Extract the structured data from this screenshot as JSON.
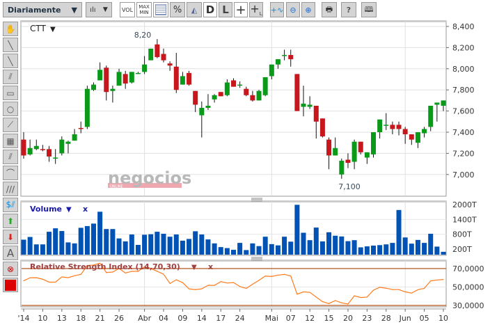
{
  "toolbar": {
    "period": "Diariamente",
    "vol": "VOL",
    "max": "MAX",
    "min": "MIN",
    "percent": "%",
    "d": "D",
    "l": "L",
    "help": "?"
  },
  "left_tools": [
    "hand",
    "line",
    "diagonal-line",
    "parallel-lines",
    "rectangle",
    "circle",
    "fan",
    "fibonacci",
    "channel",
    "arc",
    "hatch",
    "dollar-lines",
    "arrow-up",
    "arrow-down",
    "text",
    "delete",
    "color"
  ],
  "left_text_label": "A",
  "chart": {
    "symbol": "CTT",
    "high_annotation": "8,20",
    "low_annotation": "7,100",
    "watermark": "negocios",
    "watermark_sub": "ONLINE"
  },
  "volume_panel": {
    "title": "Volume",
    "close": "x"
  },
  "rsi_panel": {
    "title": "Relative Strength Index (14,70,30)",
    "close": "x"
  },
  "colors": {
    "up": "#0a9a1a",
    "down": "#c8161d",
    "volume": "#0052b4",
    "rsi": "#ff7b1c",
    "rsi_bounds": "#b5541a",
    "title_volume": "#1a1aa8",
    "title_rsi": "#a04040"
  },
  "chart_data": {
    "type": "candlestick",
    "price_axis": {
      "min": 6.85,
      "max": 8.45,
      "ticks": [
        "8,400",
        "8,200",
        "8,000",
        "7,800",
        "7,600",
        "7,400",
        "7,200",
        "7,000"
      ],
      "tick_values": [
        8.4,
        8.2,
        8.0,
        7.8,
        7.6,
        7.4,
        7.2,
        7.0
      ]
    },
    "x_labels": [
      "'14",
      "10",
      "13",
      "18",
      "21",
      "26",
      "Abr",
      "04",
      "09",
      "14",
      "17",
      "24",
      "Mai",
      "07",
      "12",
      "15",
      "20",
      "23",
      "28",
      "Jun",
      "05",
      "10"
    ],
    "x_label_index": [
      0,
      3,
      6,
      9,
      12,
      15,
      19,
      22,
      25,
      28,
      31,
      34,
      39,
      42,
      45,
      48,
      51,
      54,
      57,
      60,
      63,
      66
    ],
    "ohlc": [
      [
        7.33,
        7.4,
        7.15,
        7.18
      ],
      [
        7.19,
        7.33,
        7.18,
        7.25
      ],
      [
        7.24,
        7.33,
        7.23,
        7.27
      ],
      [
        7.24,
        7.28,
        7.22,
        7.23
      ],
      [
        7.24,
        7.27,
        7.12,
        7.17
      ],
      [
        7.155,
        7.24,
        7.1,
        7.16
      ],
      [
        7.2,
        7.36,
        7.18,
        7.33
      ],
      [
        7.29,
        7.32,
        7.2,
        7.31
      ],
      [
        7.32,
        7.43,
        7.32,
        7.38
      ],
      [
        7.44,
        7.5,
        7.39,
        7.43
      ],
      [
        7.45,
        7.84,
        7.43,
        7.81
      ],
      [
        7.8,
        7.87,
        7.79,
        7.85
      ],
      [
        7.89,
        8.06,
        7.89,
        7.99
      ],
      [
        8.01,
        8.03,
        7.7,
        7.78
      ],
      [
        7.79,
        7.84,
        7.68,
        7.81
      ],
      [
        7.84,
        8.0,
        7.84,
        7.97
      ],
      [
        7.95,
        7.98,
        7.81,
        7.86
      ],
      [
        7.87,
        7.97,
        7.86,
        7.97
      ],
      [
        7.96,
        7.97,
        7.95,
        7.96
      ],
      [
        7.97,
        8.12,
        7.95,
        8.04
      ],
      [
        8.08,
        8.19,
        8.08,
        8.19
      ],
      [
        8.23,
        8.28,
        8.1,
        8.11
      ],
      [
        8.14,
        8.19,
        8.06,
        8.08
      ],
      [
        8.05,
        8.07,
        7.98,
        8.03
      ],
      [
        8.02,
        8.15,
        7.77,
        7.8
      ],
      [
        7.85,
        7.97,
        7.85,
        7.93
      ],
      [
        7.96,
        7.98,
        7.84,
        7.85
      ],
      [
        7.79,
        7.79,
        7.59,
        7.66
      ],
      [
        7.56,
        7.69,
        7.35,
        7.63
      ],
      [
        7.63,
        7.76,
        7.61,
        7.65
      ],
      [
        7.71,
        7.76,
        7.68,
        7.75
      ],
      [
        7.78,
        7.78,
        7.74,
        7.74
      ],
      [
        7.75,
        7.9,
        7.74,
        7.87
      ],
      [
        7.89,
        7.91,
        7.83,
        7.83
      ],
      [
        7.85,
        7.88,
        7.82,
        7.85
      ],
      [
        7.81,
        7.83,
        7.74,
        7.75
      ],
      [
        7.75,
        7.79,
        7.69,
        7.7
      ],
      [
        7.7,
        7.8,
        7.7,
        7.79
      ],
      [
        7.75,
        7.92,
        7.74,
        7.92
      ],
      [
        7.93,
        8.04,
        7.9,
        8.04
      ],
      [
        8.04,
        8.09,
        8.0,
        8.09
      ],
      [
        8.13,
        8.18,
        8.08,
        8.13
      ],
      [
        8.13,
        8.18,
        8.02,
        8.09
      ],
      [
        7.95,
        7.95,
        7.6,
        7.6
      ],
      [
        7.64,
        7.84,
        7.55,
        7.67
      ],
      [
        7.64,
        7.74,
        7.62,
        7.66
      ],
      [
        7.65,
        7.65,
        7.34,
        7.5
      ],
      [
        7.53,
        7.53,
        7.35,
        7.36
      ],
      [
        7.33,
        7.35,
        7.05,
        7.18
      ],
      [
        7.18,
        7.35,
        7.18,
        7.25
      ],
      [
        7.0,
        7.15,
        6.96,
        7.13
      ],
      [
        7.14,
        7.2,
        7.06,
        7.11
      ],
      [
        7.12,
        7.33,
        7.05,
        7.31
      ],
      [
        7.31,
        7.31,
        7.19,
        7.21
      ],
      [
        7.16,
        7.21,
        7.1,
        7.21
      ],
      [
        7.19,
        7.4,
        7.16,
        7.4
      ],
      [
        7.4,
        7.52,
        7.34,
        7.52
      ],
      [
        7.47,
        7.58,
        7.42,
        7.47
      ],
      [
        7.47,
        7.5,
        7.38,
        7.43
      ],
      [
        7.47,
        7.5,
        7.37,
        7.43
      ],
      [
        7.43,
        7.45,
        7.29,
        7.38
      ],
      [
        7.38,
        7.38,
        7.28,
        7.33
      ],
      [
        7.3,
        7.4,
        7.25,
        7.4
      ],
      [
        7.39,
        7.45,
        7.35,
        7.43
      ],
      [
        7.45,
        7.65,
        7.41,
        7.65
      ],
      [
        7.66,
        7.68,
        7.5,
        7.68
      ],
      [
        7.65,
        7.7,
        7.6,
        7.7
      ]
    ],
    "volume_axis": {
      "ticks": [
        "2000T",
        "1400T",
        "800T",
        "200T"
      ],
      "tick_values": [
        2000,
        1400,
        800,
        200
      ]
    },
    "volume": [
      580,
      690,
      390,
      390,
      900,
      1040,
      930,
      470,
      430,
      1060,
      1130,
      1230,
      1710,
      1010,
      1010,
      630,
      510,
      790,
      370,
      780,
      800,
      900,
      820,
      700,
      790,
      540,
      610,
      920,
      790,
      590,
      430,
      280,
      240,
      170,
      450,
      160,
      430,
      320,
      700,
      400,
      350,
      700,
      500,
      1990,
      860,
      560,
      1070,
      510,
      880,
      740,
      710,
      520,
      560,
      270,
      310,
      340,
      360,
      390,
      450,
      1780,
      670,
      420,
      570,
      450,
      820,
      300,
      90
    ],
    "rsi_axis": {
      "ticks": [
        "70,0000",
        "50,0000",
        "30,0000"
      ],
      "tick_values": [
        70,
        50,
        30
      ]
    },
    "rsi": [
      56.8,
      59.9,
      60.1,
      58.4,
      55.3,
      55.3,
      60.9,
      60.1,
      62.2,
      63.7,
      73.3,
      73.8,
      75.8,
      65.7,
      66.2,
      70,
      65.2,
      67,
      67,
      72,
      70,
      67,
      63.9,
      53.8,
      57.8,
      54.8,
      48,
      47.2,
      48,
      51.8,
      51.8,
      55.8,
      54.3,
      54.8,
      50.5,
      48.5,
      53,
      57.3,
      61.9,
      61.4,
      62.9,
      63.7,
      61.9,
      42.2,
      44.7,
      44.2,
      39.1,
      34.1,
      32,
      35.3,
      32.8,
      31.5,
      40.4,
      38.6,
      39.1,
      46.5,
      49.7,
      48.7,
      47.2,
      47.2,
      44.7,
      43.4,
      47,
      48.5,
      56.6,
      57.6,
      58.1
    ]
  }
}
